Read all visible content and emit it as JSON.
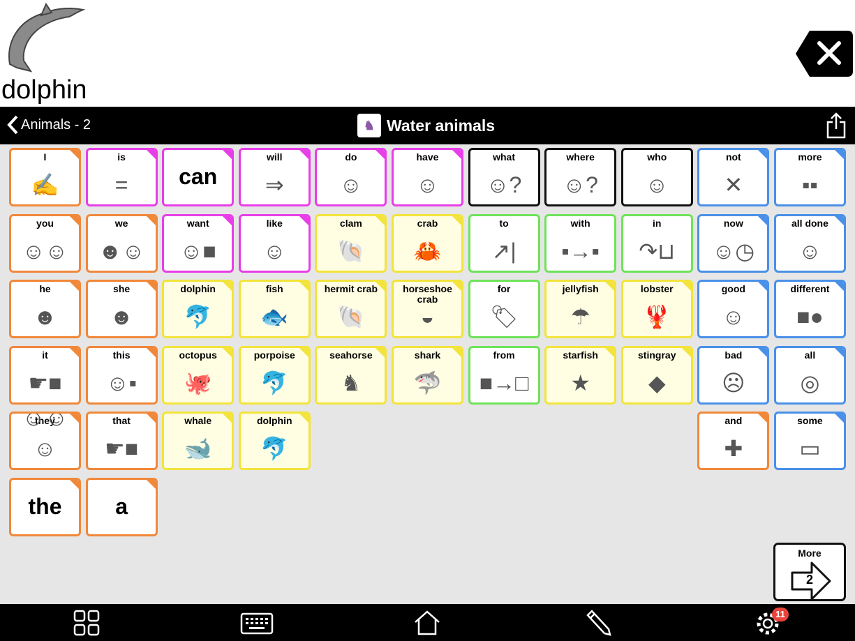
{
  "message": {
    "text": "dolphin",
    "image_icon": "dolphin"
  },
  "nav": {
    "back_label": "Animals - 2",
    "title": "Water animals"
  },
  "colors": {
    "pronoun": "#f0883a",
    "verb": "#e83ee8",
    "noun": "#f2e43c",
    "preposition": "#6ee35a",
    "question": "#111111",
    "adjective": "#4a90e8"
  },
  "cells": [
    {
      "label": "I",
      "c": "o",
      "icon": "✍"
    },
    {
      "label": "is",
      "c": "m",
      "icon": "="
    },
    {
      "label": "",
      "big": "can",
      "c": "m"
    },
    {
      "label": "will",
      "c": "m",
      "icon": "⇒"
    },
    {
      "label": "do",
      "c": "m",
      "icon": "☺"
    },
    {
      "label": "have",
      "c": "m",
      "icon": "☺"
    },
    {
      "label": "what",
      "c": "k",
      "icon": "☺?"
    },
    {
      "label": "where",
      "c": "k",
      "icon": "☺?"
    },
    {
      "label": "who",
      "c": "k",
      "icon": "☺"
    },
    {
      "label": "not",
      "c": "b",
      "icon": "✕"
    },
    {
      "label": "more",
      "c": "b",
      "icon": "▪▪"
    },
    {
      "label": "you",
      "c": "o",
      "icon": "☺☺"
    },
    {
      "label": "we",
      "c": "o",
      "icon": "☻☺"
    },
    {
      "label": "want",
      "c": "m",
      "icon": "☺■"
    },
    {
      "label": "like",
      "c": "m",
      "icon": "☺"
    },
    {
      "label": "clam",
      "c": "y",
      "icon": "🐚"
    },
    {
      "label": "crab",
      "c": "y",
      "icon": "🦀"
    },
    {
      "label": "to",
      "c": "g",
      "icon": "↗|"
    },
    {
      "label": "with",
      "c": "g",
      "icon": "▪→▪"
    },
    {
      "label": "in",
      "c": "g",
      "icon": "↷⊔"
    },
    {
      "label": "now",
      "c": "b",
      "icon": "☺◷"
    },
    {
      "label": "all done",
      "c": "b",
      "icon": "☺"
    },
    {
      "label": "he",
      "c": "o",
      "icon": "☻"
    },
    {
      "label": "she",
      "c": "o",
      "icon": "☻"
    },
    {
      "label": "dolphin",
      "c": "y",
      "icon": "🐬"
    },
    {
      "label": "fish",
      "c": "y",
      "icon": "🐟"
    },
    {
      "label": "hermit crab",
      "c": "y",
      "icon": "🐚"
    },
    {
      "label": "horseshoe crab",
      "c": "y",
      "icon": "◒"
    },
    {
      "label": "for",
      "c": "g",
      "icon": "🏷"
    },
    {
      "label": "jellyfish",
      "c": "y",
      "icon": "☂"
    },
    {
      "label": "lobster",
      "c": "y",
      "icon": "🦞"
    },
    {
      "label": "good",
      "c": "b",
      "icon": "☺"
    },
    {
      "label": "different",
      "c": "b",
      "icon": "■●"
    },
    {
      "label": "it",
      "c": "o",
      "icon": "☛■"
    },
    {
      "label": "this",
      "c": "o",
      "icon": "☺▪"
    },
    {
      "label": "octopus",
      "c": "y",
      "icon": "🐙"
    },
    {
      "label": "porpoise",
      "c": "y",
      "icon": "🐬"
    },
    {
      "label": "seahorse",
      "c": "y",
      "icon": "♞"
    },
    {
      "label": "shark",
      "c": "y",
      "icon": "🦈"
    },
    {
      "label": "from",
      "c": "g",
      "icon": "■→□"
    },
    {
      "label": "starfish",
      "c": "y",
      "icon": "★"
    },
    {
      "label": "stingray",
      "c": "y",
      "icon": "◆"
    },
    {
      "label": "bad",
      "c": "b",
      "icon": "☹"
    },
    {
      "label": "all",
      "c": "b",
      "icon": "◎"
    },
    {
      "label": "they",
      "c": "o",
      "icon": "☺☺☺"
    },
    {
      "label": "that",
      "c": "o",
      "icon": "☛■"
    },
    {
      "label": "whale",
      "c": "y",
      "icon": "🐋"
    },
    {
      "label": "dolphin",
      "c": "y",
      "icon": "🐬"
    },
    null,
    null,
    null,
    null,
    null,
    {
      "label": "and",
      "c": "o",
      "icon": "✚"
    },
    {
      "label": "some",
      "c": "b",
      "icon": "▭"
    },
    {
      "label": "",
      "big": "the",
      "c": "o"
    },
    {
      "label": "",
      "big": "a",
      "c": "o"
    }
  ],
  "more_button": {
    "label": "More",
    "page": "2"
  },
  "bottom_bar": {
    "items": [
      "grid-icon",
      "keyboard-icon",
      "home-icon",
      "pencil-icon",
      "gear-icon"
    ],
    "settings_badge": "11"
  }
}
